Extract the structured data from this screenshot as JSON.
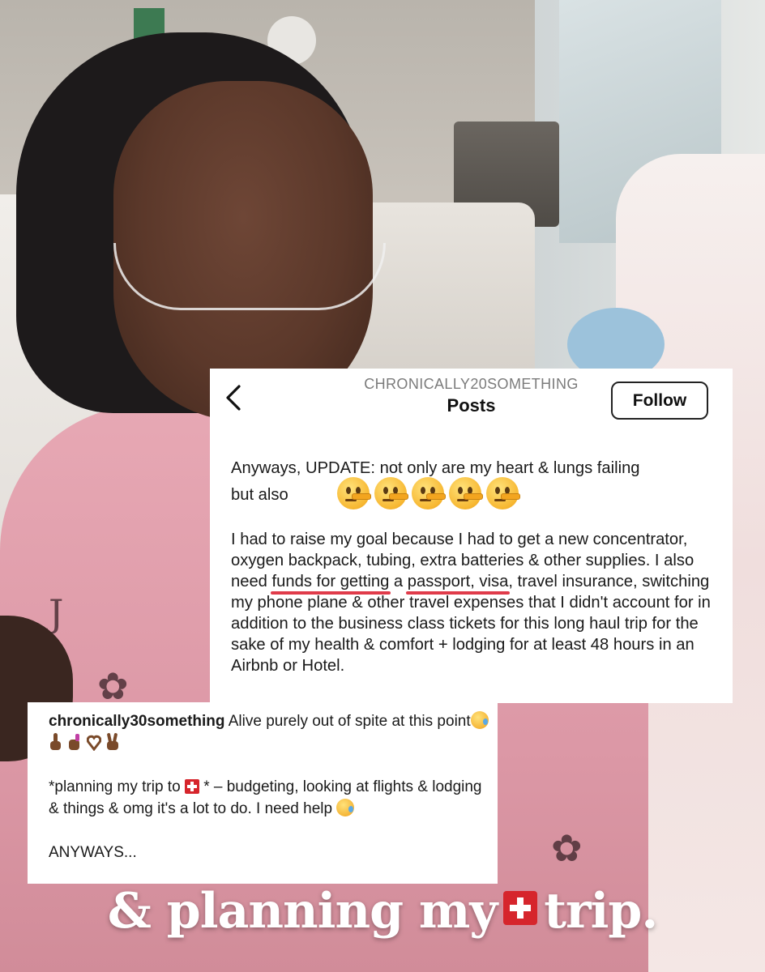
{
  "post_header": {
    "account": "CHRONICALLY20SOMETHING",
    "title": "Posts",
    "follow_label": "Follow",
    "back_icon": "chevron-left-icon"
  },
  "post_body": {
    "line1": "Anyways, UPDATE: not only are my heart & lungs failing",
    "line2": "but also",
    "emoji_name": "lying-face-icon",
    "emoji_count": 5,
    "para_a": "I had to raise my goal because I had to get a new concentrator, oxygen backpack, tubing, extra batteries & other supplies. I also need ",
    "underline1": "funds for getting",
    "para_b": " a ",
    "underline2": "passport, visa",
    "para_c": ", travel insurance, switching my phone plane & other travel expenses that I didn't account for in addition to the business class tickets for this long haul trip for the sake of my health & comfort + lodging for at least 48 hours in an Airbnb or Hotel."
  },
  "caption": {
    "username": "chronically30something",
    "text1": " Alive purely out of spite at this point",
    "text2_a": "*planning my trip to ",
    "text2_b": " * – budgeting, looking at flights & lodging & things & omg it's a lot to do. I need help ",
    "text3": "ANYWAYS..."
  },
  "overlay": {
    "part1": "& planning my",
    "part2": "trip."
  },
  "colors": {
    "underline": "#e03b4a",
    "swiss_red": "#d6252c",
    "card_bg": "#ffffff"
  }
}
